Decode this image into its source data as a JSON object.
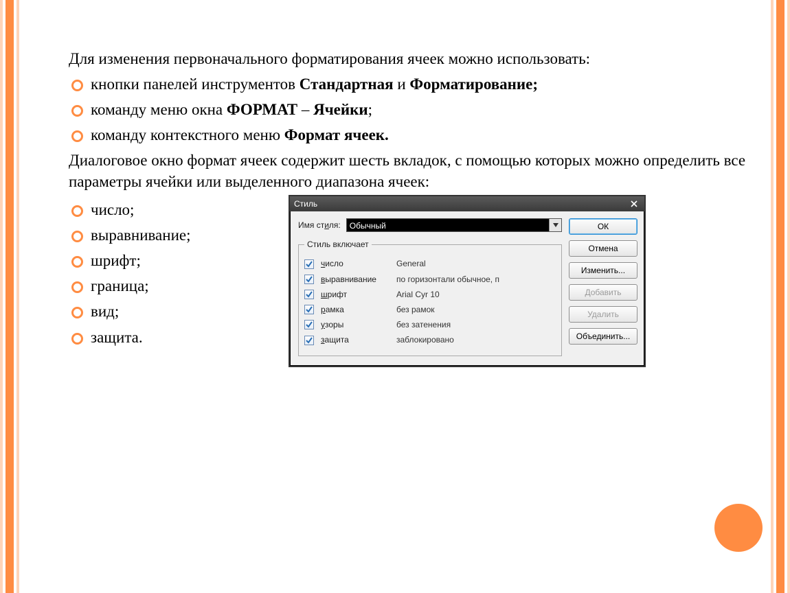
{
  "intro": "Для изменения первоначального форматирования ячеек можно использовать:",
  "bullets_top": [
    {
      "t1": "кнопки панелей инструментов ",
      "b1": "Стандартная",
      "t2": " и ",
      "b2": "Форматирование;"
    },
    {
      "t1": "команду меню окна ",
      "b1": "ФОРМАТ",
      "t2": " – ",
      "b2": "Ячейки",
      "t3": ";"
    },
    {
      "t1": "команду контекстного меню ",
      "b1": "Формат ячеек."
    }
  ],
  "middle": "Диалоговое окно формат ячеек содержит шесть вкладок, с помощью которых можно определить все параметры ячейки или выделенного диапазона ячеек:",
  "list_tabs": [
    "число;",
    "выравнивание;",
    "шрифт;",
    "граница;",
    "вид;",
    "защита."
  ],
  "dialog": {
    "title": "Стиль",
    "close_icon": "✕",
    "name_label": "Имя ст_иля:",
    "name_value": "Обычный",
    "group_label": "Стиль включает",
    "options": [
      {
        "name": "число",
        "u": "ч",
        "value": "General"
      },
      {
        "name": "выравнивание",
        "u": "в",
        "value": "по горизонтали обычное, п"
      },
      {
        "name": "шрифт",
        "u": "ш",
        "value": "Arial Cyr 10"
      },
      {
        "name": "рамка",
        "u": "р",
        "value": "без рамок"
      },
      {
        "name": "узоры",
        "u": "у",
        "value": "без затенения"
      },
      {
        "name": "защита",
        "u": "з",
        "value": "заблокировано"
      }
    ],
    "buttons": {
      "ok": "ОК",
      "cancel": "Отмена",
      "modify": "Изменить...",
      "add": "Добавить",
      "delete": "Удалить",
      "merge": "Объединить..."
    }
  }
}
